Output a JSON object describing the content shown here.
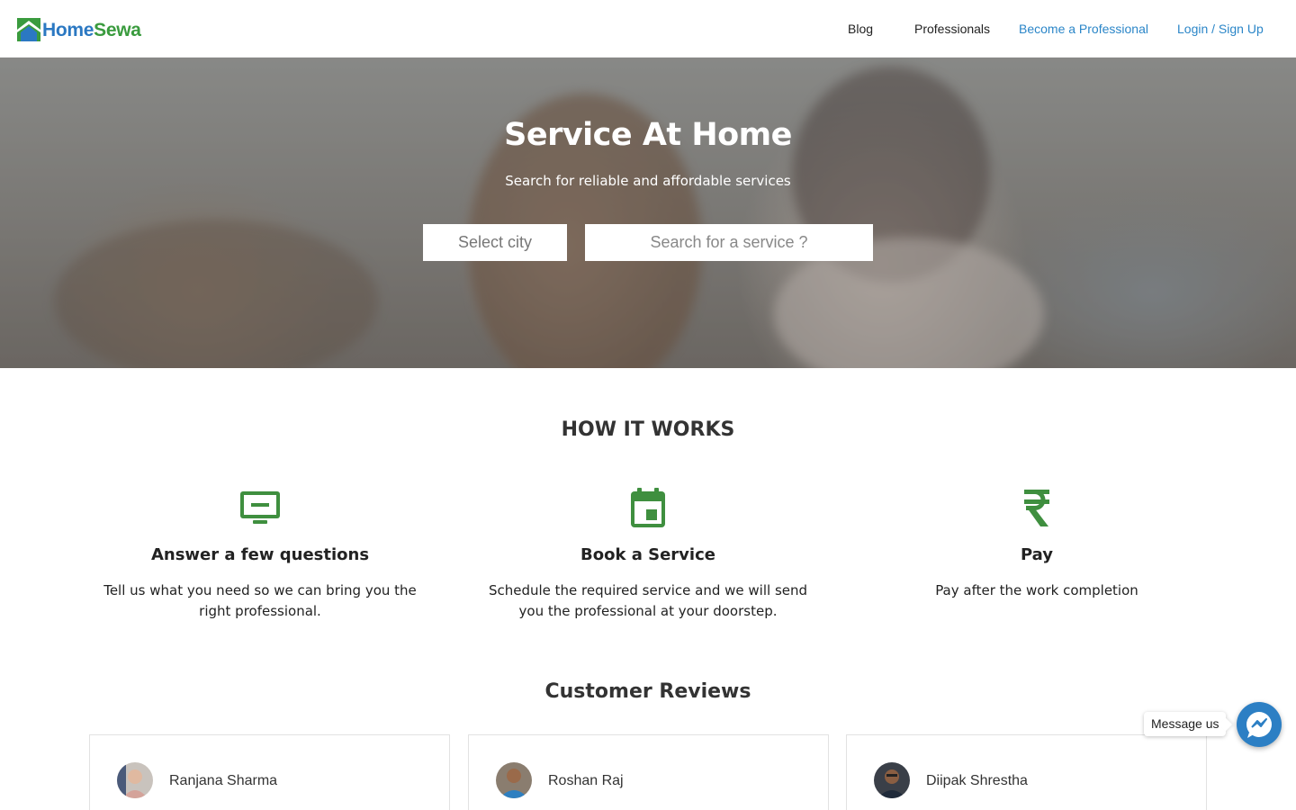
{
  "brand": {
    "name_part1": "Home",
    "name_part2": "Sewa",
    "color_home": "#2b78c2",
    "color_sewa": "#3a9b3e"
  },
  "nav": {
    "items": [
      {
        "label": "Blog"
      },
      {
        "label": "Professionals"
      },
      {
        "label": "Become a Professional"
      },
      {
        "label": "Login / Sign Up"
      }
    ]
  },
  "hero": {
    "title": "Service At Home",
    "subtitle": "Search for reliable and affordable services",
    "city_select_value": "Select city",
    "search_placeholder": "Search for a service ?"
  },
  "how_it_works": {
    "title": "HOW IT WORKS",
    "steps": [
      {
        "icon": "monitor-icon",
        "title": "Answer a few questions",
        "description": "Tell us what you need so we can bring you the right professional."
      },
      {
        "icon": "calendar-icon",
        "title": "Book a Service",
        "description": "Schedule the required service and we will send you the professional at your doorstep."
      },
      {
        "icon": "rupee-icon",
        "title": "Pay",
        "description": "Pay after the work completion"
      }
    ],
    "accent_color": "#3f8f3f"
  },
  "reviews": {
    "title": "Customer Reviews",
    "items": [
      {
        "name": "Ranjana Sharma"
      },
      {
        "name": "Roshan Raj"
      },
      {
        "name": "Diipak Shrestha"
      }
    ]
  },
  "messenger": {
    "label": "Message us",
    "color": "#2c7fc4"
  }
}
